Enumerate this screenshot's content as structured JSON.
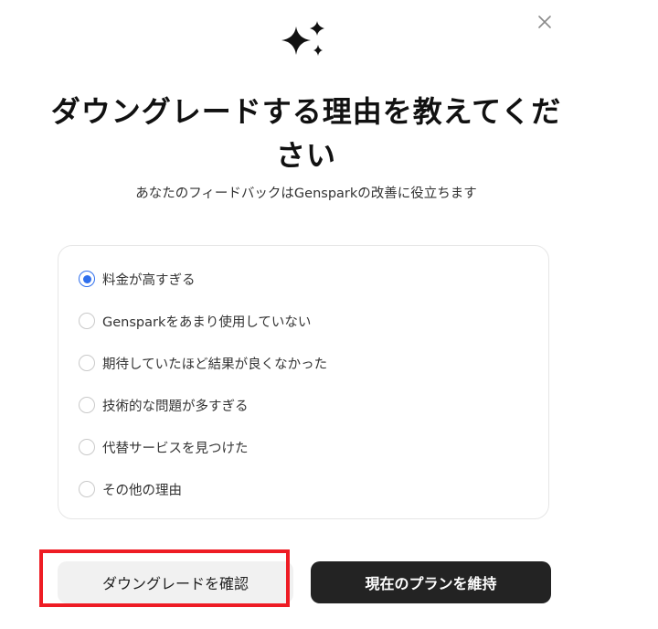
{
  "dialog": {
    "close_icon": "close-icon",
    "header_icon": "sparkle-icon",
    "title_line1": "ダウングレードする理由を教えてくだ",
    "title_line2": "さい",
    "subtitle": "あなたのフィードバックはGensparkの改善に役立ちます"
  },
  "reasons": [
    {
      "label": "料金が高すぎる",
      "selected": true
    },
    {
      "label": "Gensparkをあまり使用していない",
      "selected": false
    },
    {
      "label": "期待していたほど結果が良くなかった",
      "selected": false
    },
    {
      "label": "技術的な問題が多すぎる",
      "selected": false
    },
    {
      "label": "代替サービスを見つけた",
      "selected": false
    },
    {
      "label": "その他の理由",
      "selected": false
    }
  ],
  "actions": {
    "confirm_downgrade_label": "ダウングレードを確認",
    "keep_plan_label": "現在のプランを維持"
  },
  "colors": {
    "accent": "#2f6fed",
    "highlight": "#ee1c24",
    "primary_button": "#232323"
  }
}
